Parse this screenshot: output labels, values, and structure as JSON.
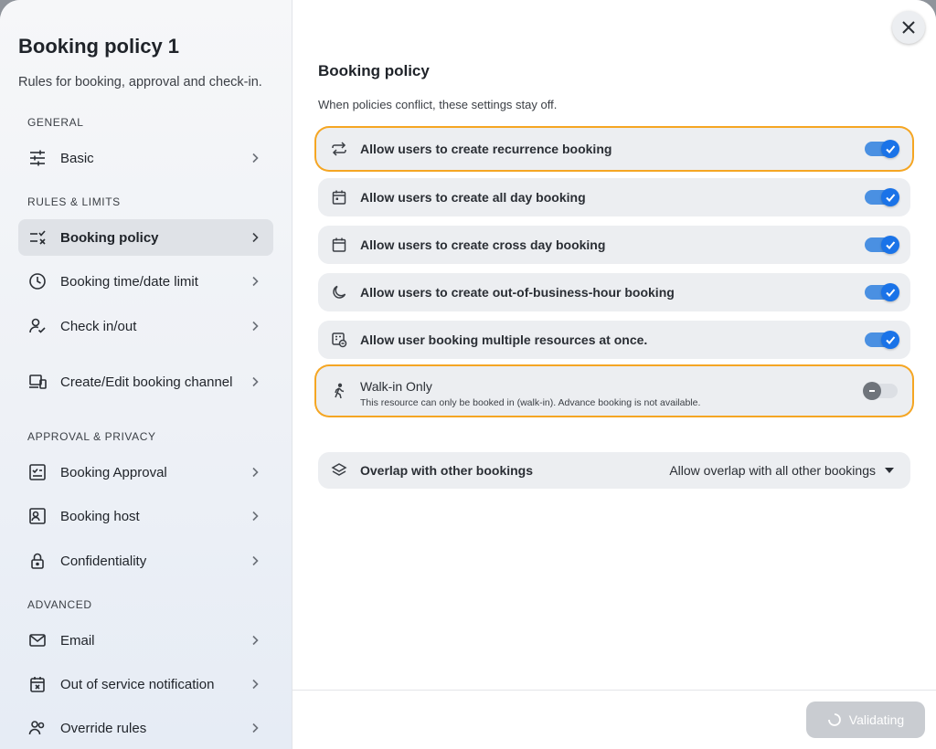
{
  "sidebar": {
    "title": "Booking policy 1",
    "subtitle": "Rules for booking, approval and check-in.",
    "sections": {
      "general": "GENERAL",
      "rules_limits": "RULES & LIMITS",
      "approval_privacy": "APPROVAL & PRIVACY",
      "advanced": "ADVANCED"
    },
    "items": [
      {
        "label": "Basic",
        "icon": "sliders-icon"
      },
      {
        "label": "Booking policy",
        "icon": "list-check-icon",
        "active": true
      },
      {
        "label": "Booking time/date limit",
        "icon": "clock-icon"
      },
      {
        "label": "Check in/out",
        "icon": "user-check-icon"
      },
      {
        "label": "Create/Edit booking channel",
        "icon": "devices-icon"
      },
      {
        "label": "Booking Approval",
        "icon": "approval-icon"
      },
      {
        "label": "Booking host",
        "icon": "host-icon"
      },
      {
        "label": "Confidentiality",
        "icon": "lock-icon"
      },
      {
        "label": "Email",
        "icon": "mail-icon"
      },
      {
        "label": "Out of service notification",
        "icon": "calendar-x-icon"
      },
      {
        "label": "Override rules",
        "icon": "users-icon"
      }
    ]
  },
  "main": {
    "title": "Booking policy",
    "description": "When policies conflict, these settings stay off.",
    "settings": [
      {
        "label": "Allow users to create recurrence booking",
        "icon": "repeat-icon",
        "enabled": true,
        "highlighted": true
      },
      {
        "label": "Allow users to create all day booking",
        "icon": "calendar-icon",
        "enabled": true
      },
      {
        "label": "Allow users to create cross day booking",
        "icon": "calendar-range-icon",
        "enabled": true
      },
      {
        "label": "Allow users to create out-of-business-hour booking",
        "icon": "moon-icon",
        "enabled": true
      },
      {
        "label": "Allow user booking multiple resources at once.",
        "icon": "multi-resource-icon",
        "enabled": true
      }
    ],
    "walk_in": {
      "label": "Walk-in Only",
      "description": "This resource can only be booked in (walk-in). Advance booking is not available.",
      "icon": "walk-icon",
      "enabled": false,
      "highlighted": true
    },
    "overlap": {
      "label": "Overlap with other bookings",
      "icon": "layers-icon",
      "selected": "Allow overlap with all other bookings"
    }
  },
  "footer": {
    "validate_label": "Validating"
  },
  "colors": {
    "accent": "#1a73e8",
    "highlight": "#f5a623",
    "row_bg": "#eceef1"
  }
}
